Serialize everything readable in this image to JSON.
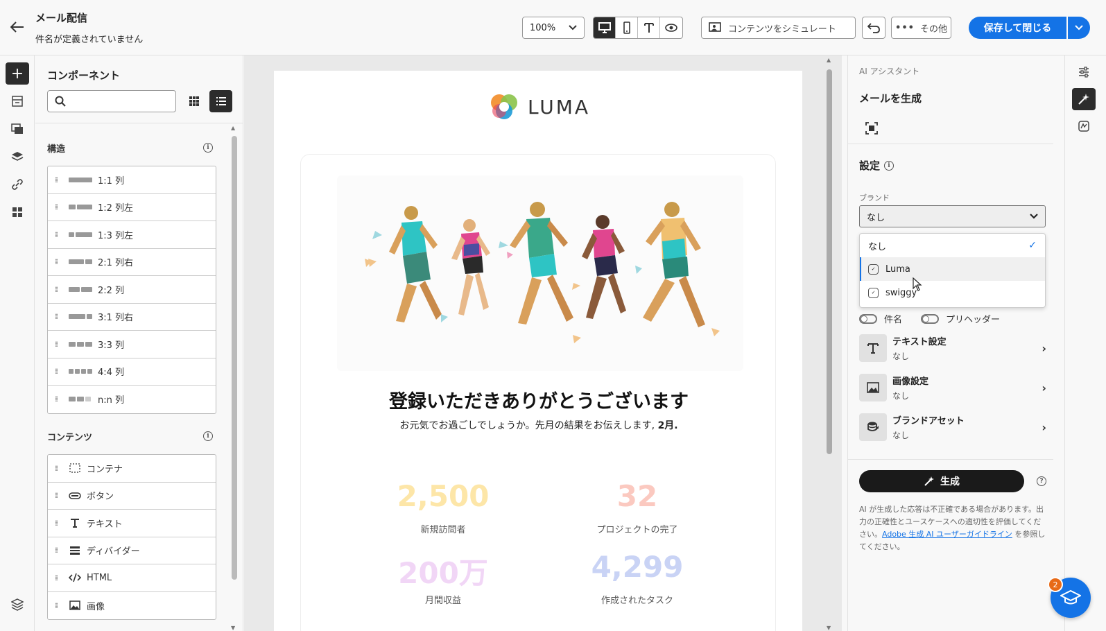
{
  "header": {
    "title": "メール配信",
    "subtitle": "件名が定義されていません",
    "zoom": "100%",
    "simulate_label": "コンテンツをシミュレート",
    "more_label": "その他",
    "save_label": "保存して閉じる",
    "accent": "#1473e6"
  },
  "components": {
    "title": "コンポーネント",
    "search_placeholder": "",
    "structure_heading": "構造",
    "structure_items": [
      "1:1 列",
      "1:2 列左",
      "1:3 列左",
      "2:1 列右",
      "2:2 列",
      "3:1 列右",
      "3:3 列",
      "4:4 列",
      "n:n 列"
    ],
    "content_heading": "コンテンツ",
    "content_items": [
      "コンテナ",
      "ボタン",
      "テキスト",
      "ディバイダー",
      "HTML",
      "画像"
    ]
  },
  "email": {
    "brand": "LUMA",
    "headline": "登録いただきありがとうございます",
    "subline_prefix": "お元気でお過ごしでしょうか。先月の結果をお伝えします, ",
    "subline_month": "2月.",
    "stats": [
      {
        "value": "2,500",
        "label": "新規訪問者",
        "color": "#fde6a8"
      },
      {
        "value": "32",
        "label": "プロジェクトの完了",
        "color": "#fbc9c0"
      },
      {
        "value": "200万",
        "label": "月間収益",
        "color": "#f1d6f6"
      },
      {
        "value": "4,299",
        "label": "作成されたタスク",
        "color": "#c9d3f5"
      }
    ]
  },
  "ai": {
    "crumb": "AI アシスタント",
    "title": "メールを生成",
    "settings_label": "設定",
    "brand_label": "ブランド",
    "brand_selected": "なし",
    "brand_options": [
      "なし",
      "Luma",
      "swiggy"
    ],
    "toggle_subject": "件名",
    "toggle_preheader": "プリヘッダー",
    "settings_rows": [
      {
        "name": "テキスト設定",
        "value": "なし"
      },
      {
        "name": "画像設定",
        "value": "なし"
      },
      {
        "name": "ブランドアセット",
        "value": "なし"
      }
    ],
    "generate_label": "生成",
    "disclaimer_text": "AI が生成した応答は不正確である場合があります。出力の正確性とユースケースへの適切性を評価してください。",
    "disclaimer_link": "Adobe 生成 AI ユーザーガイドライン",
    "disclaimer_suffix": " を参照してください。"
  },
  "help": {
    "badge": "2"
  }
}
